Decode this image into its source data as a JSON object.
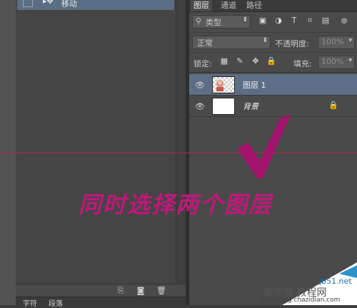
{
  "history": {
    "item_label": "移动",
    "footer_icons": [
      "new-snapshot-icon",
      "camera-icon",
      "trash-icon"
    ]
  },
  "bottom_tabs": [
    "字符",
    "段落"
  ],
  "layers_panel": {
    "tabs": [
      "图层",
      "通道",
      "路径"
    ],
    "filter_label": "类型",
    "blend_mode": "正常",
    "opacity_label": "不透明度:",
    "opacity_value": "100%",
    "lock_label": "锁定:",
    "fill_label": "填充:",
    "fill_value": "100%",
    "layers": [
      {
        "name": "图层 1",
        "selected": true
      },
      {
        "name": "背景",
        "selected": false
      }
    ]
  },
  "annotation": {
    "text": "同时选择两个图层",
    "color": "#c0187a"
  },
  "watermark": {
    "site": "jb51.net",
    "brand": "查字典 教程网",
    "url": "jiaocheng.chazidian.com"
  },
  "colors": {
    "selection": "#5d6f86",
    "accent_magenta": "#a3136c",
    "guide_line": "#b0264e"
  }
}
